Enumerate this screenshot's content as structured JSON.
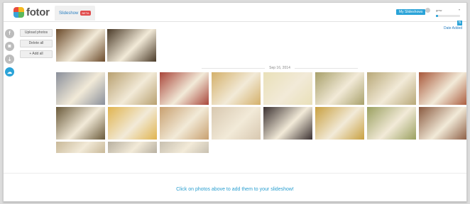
{
  "app": {
    "name": "fotor",
    "tab_label": "Slideshow",
    "tab_badge": "BETA"
  },
  "header": {
    "my_slideshows_label": "My Slideshows",
    "user_name": "gmw",
    "progress": 0.1
  },
  "sidebar": {
    "items": [
      {
        "name": "facebook-icon",
        "glyph": "f",
        "active": false
      },
      {
        "name": "instagram-icon",
        "glyph": "◙",
        "active": false
      },
      {
        "name": "dropbox-icon",
        "glyph": "⇣",
        "active": false
      },
      {
        "name": "upload-cloud-icon",
        "glyph": "☁",
        "active": true
      }
    ]
  },
  "actions": {
    "upload": "Upload photos",
    "delete": "Delete all",
    "add_all": "+ Add all"
  },
  "sort": {
    "label": "Date Added"
  },
  "photos": {
    "date_label": "Sep 16, 2014",
    "thumb_colors": [
      "#6b4a2a",
      "#4a3a28",
      "#8a8f9a",
      "#b8a070",
      "#a9463a",
      "#d4b06a",
      "#e9e0b8",
      "#a8a06a",
      "#b8a878",
      "#a8583a",
      "#6a5a3a",
      "#e0b450",
      "#c8a070",
      "#d8c8b0",
      "#3a3030",
      "#c8a040",
      "#9aa060",
      "#8a5a40",
      "#c8b898",
      "#b8b0a0",
      "#c8c0b0"
    ]
  },
  "footer": {
    "hint": "Click on photos above to add them to your slideshow!"
  }
}
